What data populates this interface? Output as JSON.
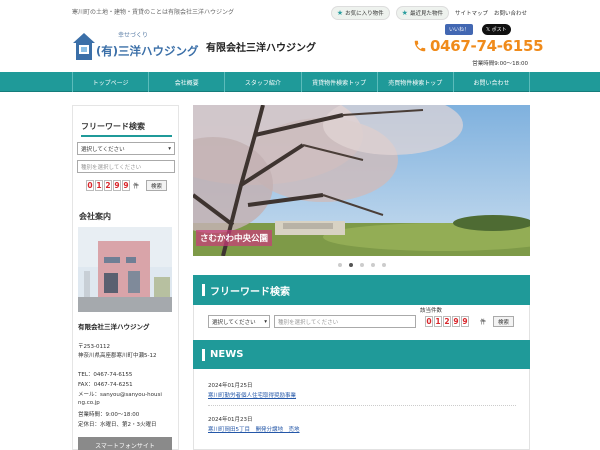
{
  "header": {
    "tagline": "寒川町の土地・建物・賃貸のことは有限会社三洋ハウジング",
    "favorites": "お気に入り物件",
    "recent": "最近見た物件",
    "sitemap": "サイトマップ",
    "contact_link": "お問い合わせ",
    "logo_sub": "幸せづくり",
    "logo_main": "(有)三洋ハウジング",
    "company": "有限会社三洋ハウジング",
    "like": "いいね！",
    "post": "ポスト",
    "phone": "0467-74-6155",
    "hours": "営業時間9:00～18:00"
  },
  "nav": [
    "トップページ",
    "会社概要",
    "スタッフ紹介",
    "賃貸物件検索トップ",
    "売買物件検索トップ",
    "お問い合わせ"
  ],
  "sidebar": {
    "search_title": "フリーワード検索",
    "select_value": "選択してください",
    "type_placeholder": "種別を選択してください",
    "count_digits": [
      "0",
      "1",
      "2",
      "9",
      "9"
    ],
    "count_unit": "件",
    "search_button": "検索",
    "company_title": "会社案内",
    "company_name": "有限会社三洋ハウジング",
    "postal": "〒253-0112",
    "address": "神奈川県高座郡寒川町中瀬5-12",
    "tel": "TEL：0467-74-6155",
    "fax": "FAX：0467-74-6251",
    "mail1": "メール：sanyou@sanyou-housi",
    "mail2": "ng.co.jp",
    "biz_hours": "営業時間：9:00～18:00",
    "closed": "定休日：水曜日、第2・3火曜日",
    "smartphone": "スマートフォンサイト"
  },
  "slider": {
    "caption": "さむかわ中央公園",
    "active_dot": 2
  },
  "search": {
    "title": "フリーワード検索",
    "select_value": "選択してください",
    "keyword_placeholder": "種別を選択してください",
    "hit_label": "該当件数",
    "count_digits": [
      "0",
      "1",
      "2",
      "9",
      "9"
    ],
    "count_unit": "件",
    "search_button": "検索"
  },
  "news": {
    "title": "NEWS",
    "items": [
      {
        "date": "2024年01月25日",
        "title": "寒川町勤労者個人住宅取得奨励事業"
      },
      {
        "date": "2024年01月23日",
        "title": "寒川町岡田5丁目　開発分譲地　売地"
      }
    ]
  },
  "colors": {
    "accent": "#1f9a99",
    "phone": "#f08b1b",
    "counter": "#d9262b",
    "link": "#2457a8"
  }
}
